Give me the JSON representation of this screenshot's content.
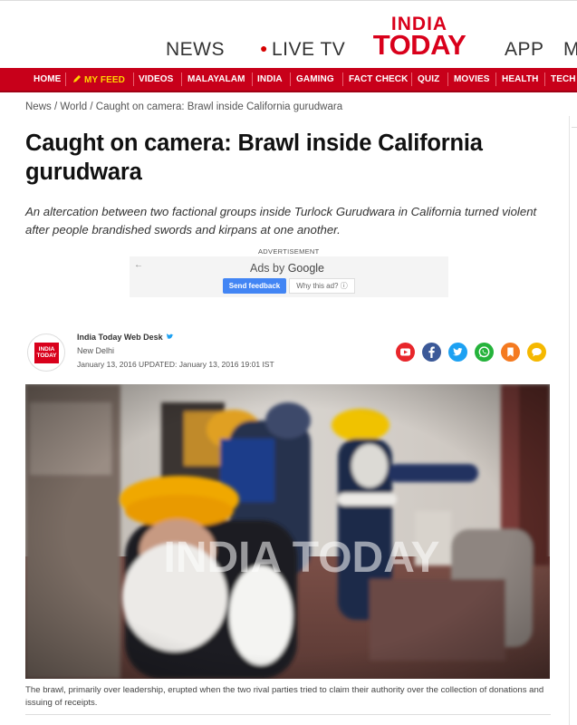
{
  "header": {
    "links": {
      "news": "NEWS",
      "live": "LIVE TV",
      "app": "APP",
      "more": "M"
    },
    "logo": {
      "line1": "INDIA",
      "line2": "TODAY"
    },
    "colors": {
      "brand_red": "#d9001b",
      "nav_red": "#c8001a",
      "feed_yellow": "#ffd400"
    }
  },
  "nav": {
    "items": [
      "HOME",
      "MY FEED",
      "VIDEOS",
      "MALAYALAM",
      "INDIA",
      "GAMING",
      "FACT CHECK",
      "QUIZ",
      "MOVIES",
      "HEALTH",
      "TECH"
    ]
  },
  "breadcrumb": {
    "news": "News",
    "sep1": " / ",
    "world": "World",
    "sep2": " / ",
    "current": "Caught on camera: Brawl inside California gurudwara"
  },
  "article": {
    "headline": "Caught on camera: Brawl inside California gurudwara",
    "summary": "An altercation between two factional groups inside Turlock Gurudwara in California turned violent after people brandished swords and kirpans at one another."
  },
  "ad": {
    "label": "ADVERTISEMENT",
    "ads_by": "Ads by ",
    "google": "Google",
    "send_feedback": "Send feedback",
    "why_this_ad": "Why this ad? ⓘ"
  },
  "author": {
    "logo_text": "INDIA TODAY",
    "name": "India Today Web Desk",
    "location": "New Delhi",
    "dates": "January 13, 2016 UPDATED: January 13, 2016 19:01 IST"
  },
  "share": {
    "icons": [
      "youtube-icon",
      "facebook-icon",
      "twitter-icon",
      "whatsapp-icon",
      "bookmark-icon",
      "comment-icon"
    ],
    "colors": [
      "#e8262b",
      "#3b5998",
      "#1da1f2",
      "#25b33b",
      "#f47a20",
      "#f5b800"
    ]
  },
  "video": {
    "watermark": "INDIA TODAY"
  },
  "caption": "The brawl, primarily over leadership, erupted when the two rival parties tried to claim their authority over the collection of donations and issuing of receipts."
}
